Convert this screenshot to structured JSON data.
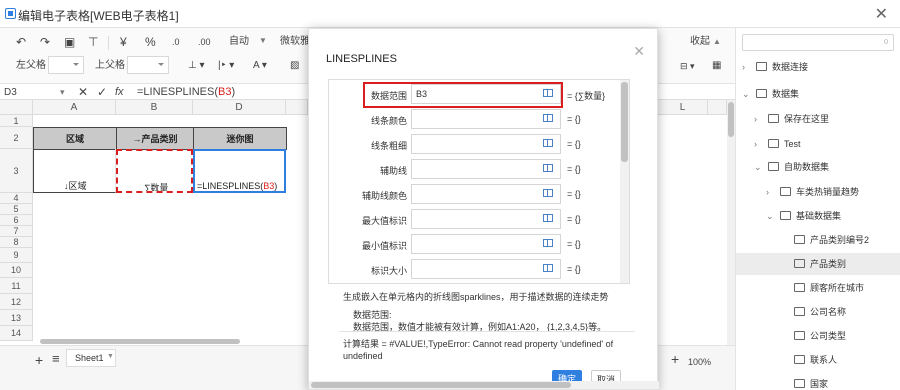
{
  "window": {
    "title": "编辑电子表格[WEB电子表格1]"
  },
  "toolbar": {
    "row1": {
      "currency": "¥",
      "percent": "%",
      "dec_inc": ".0",
      "dec_dec": ".00",
      "auto_label": "自动",
      "font_name": "微软雅",
      "collapse_label": "收起"
    },
    "row2": {
      "border_left": "左父格",
      "border_top": "上父格"
    }
  },
  "formula_bar": {
    "cell_ref": "D3",
    "fx": "fx",
    "formula_prefix": "=LINESPLINES(",
    "formula_arg": "B3",
    "formula_suffix": ")"
  },
  "sheet": {
    "columns": [
      "A",
      "B",
      "D",
      "L"
    ],
    "rows": [
      "1",
      "2",
      "3",
      "4",
      "5",
      "6",
      "7",
      "8",
      "9",
      "10",
      "11",
      "12",
      "13",
      "14"
    ],
    "header_cells": {
      "a": "区域",
      "b": "→产品类别",
      "d": "迷你图"
    },
    "data_cells": {
      "a": "↓区域",
      "b": "∑数量",
      "d_prefix": "=LINESPLINES(",
      "d_arg": "B3",
      "d_suffix": ")"
    },
    "tab_name": "Sheet1",
    "zoom": "100%"
  },
  "right_panel": {
    "tree": [
      {
        "label": "数据连接",
        "level": 0,
        "expanded": false
      },
      {
        "label": "数据集",
        "level": 0,
        "expanded": true
      },
      {
        "label": "保存在这里",
        "level": 1,
        "expanded": false
      },
      {
        "label": "Test",
        "level": 1,
        "expanded": false
      },
      {
        "label": "自助数据集",
        "level": 1,
        "expanded": true
      },
      {
        "label": "车类热销量趋势",
        "level": 2,
        "expanded": false
      },
      {
        "label": "基础数据集",
        "level": 2,
        "expanded": true
      },
      {
        "label": "产品类别编号2",
        "level": 3
      },
      {
        "label": "产品类别",
        "level": 3,
        "selected": true
      },
      {
        "label": "顾客所在城市",
        "level": 3
      },
      {
        "label": "公司名称",
        "level": 3
      },
      {
        "label": "公司类型",
        "level": 3
      },
      {
        "label": "联系人",
        "level": 3
      },
      {
        "label": "国家",
        "level": 3
      }
    ]
  },
  "dialog": {
    "title": "LINESPLINES",
    "params": [
      {
        "label": "数据范围",
        "value": "B3",
        "result": "= {∑数量}"
      },
      {
        "label": "线条颜色",
        "value": "",
        "result": "= {}"
      },
      {
        "label": "线条粗细",
        "value": "",
        "result": "= {}"
      },
      {
        "label": "辅助线",
        "value": "",
        "result": "= {}"
      },
      {
        "label": "辅助线颜色",
        "value": "",
        "result": "= {}"
      },
      {
        "label": "最大值标识",
        "value": "",
        "result": "= {}"
      },
      {
        "label": "最小值标识",
        "value": "",
        "result": "= {}"
      },
      {
        "label": "标识大小",
        "value": "",
        "result": "= {}"
      }
    ],
    "description": "生成嵌入在单元格内的折线图sparklines，用于描述数据的连续走势",
    "param_help_title": "数据范围:",
    "param_help_text": "数据范围，数值才能被有效计算，例如A1:A20， {1,2,3,4,5}等。",
    "result_line1": "计算结果 = #VALUE!,TypeError: Cannot read property 'undefined' of",
    "result_line2": "undefined",
    "ok_label": "确定",
    "cancel_label": "取消"
  },
  "colors": {
    "accent": "#2f7fe0",
    "highlight": "#d81e1e",
    "header_fill": "#c9c9c9"
  }
}
